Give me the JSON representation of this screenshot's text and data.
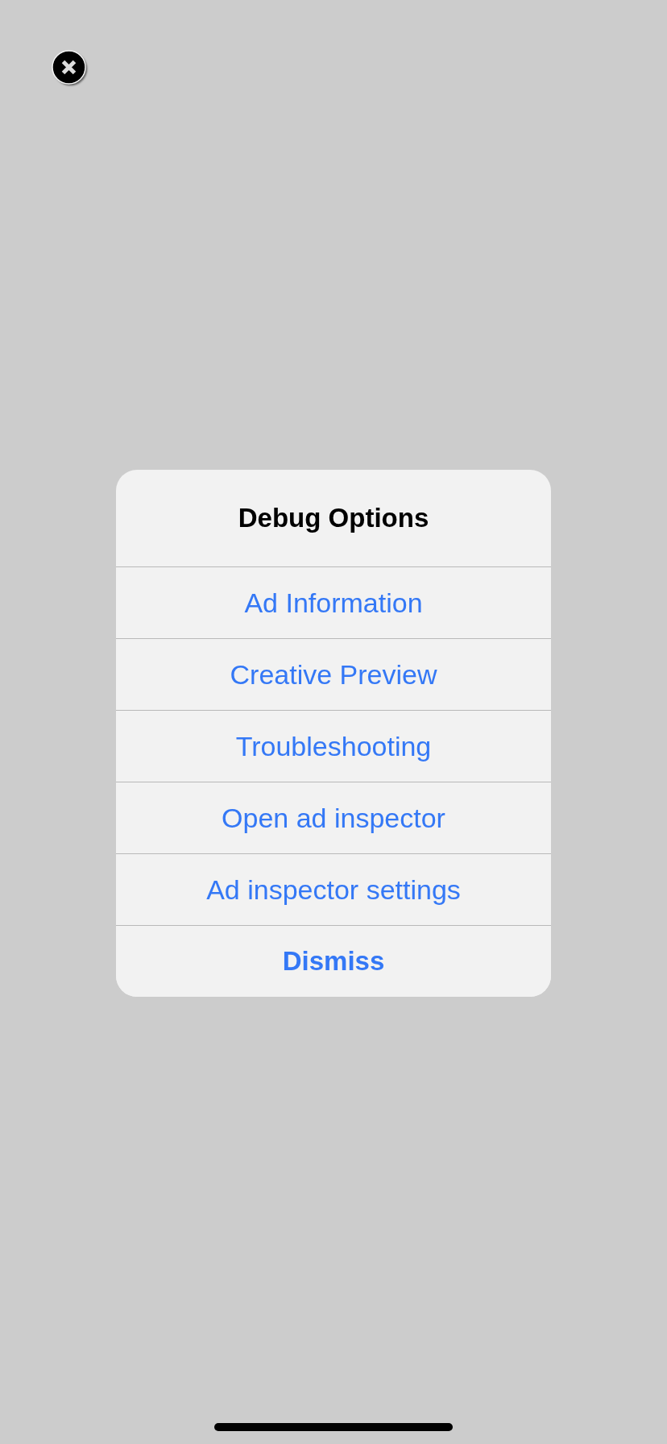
{
  "dialog": {
    "title": "Debug Options",
    "actions": [
      {
        "label": "Ad Information",
        "kind": "default"
      },
      {
        "label": "Creative Preview",
        "kind": "default"
      },
      {
        "label": "Troubleshooting",
        "kind": "default"
      },
      {
        "label": "Open ad inspector",
        "kind": "default"
      },
      {
        "label": "Ad inspector settings",
        "kind": "default"
      },
      {
        "label": "Dismiss",
        "kind": "cancel"
      }
    ]
  }
}
